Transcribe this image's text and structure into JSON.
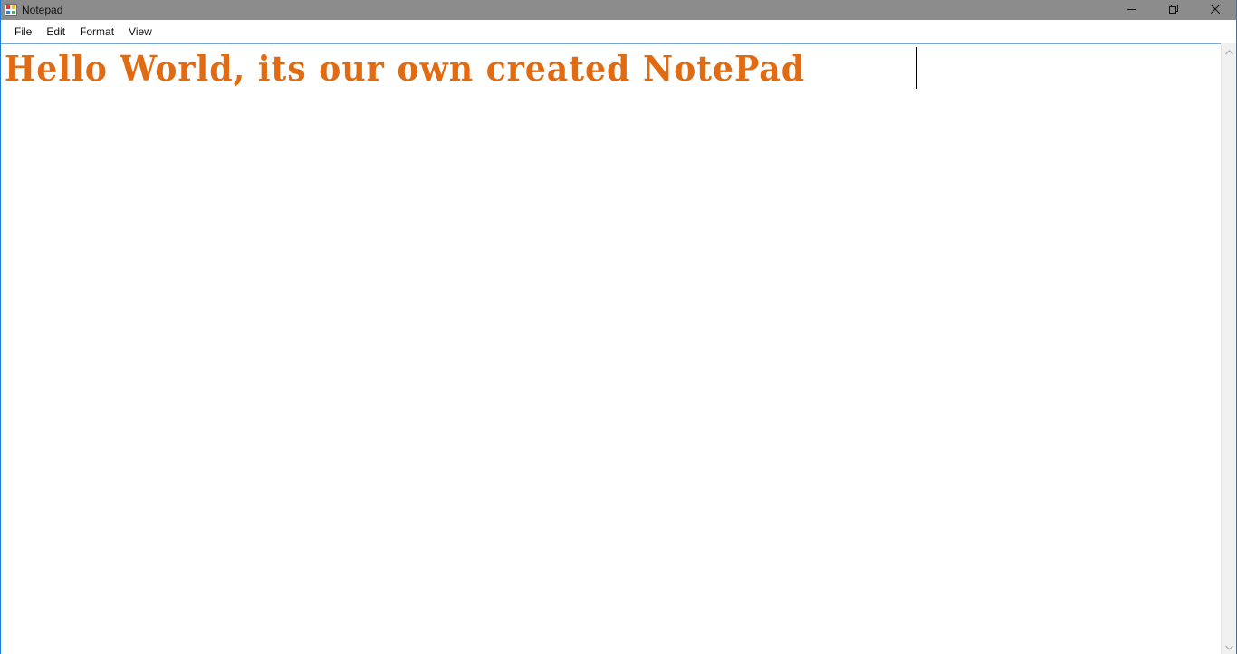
{
  "window": {
    "title": "Notepad",
    "controls": {
      "minimize_icon": "minimize-icon",
      "restore_icon": "restore-icon",
      "close_icon": "close-icon"
    }
  },
  "menubar": {
    "items": [
      {
        "label": "File"
      },
      {
        "label": "Edit"
      },
      {
        "label": "Format"
      },
      {
        "label": "View"
      }
    ]
  },
  "editor": {
    "content": "Hello World, its our own created NotePad",
    "text_color": "#e06b12"
  },
  "scrollbar": {
    "up_icon": "scroll-up-arrow-icon",
    "down_icon": "scroll-down-arrow-icon"
  }
}
